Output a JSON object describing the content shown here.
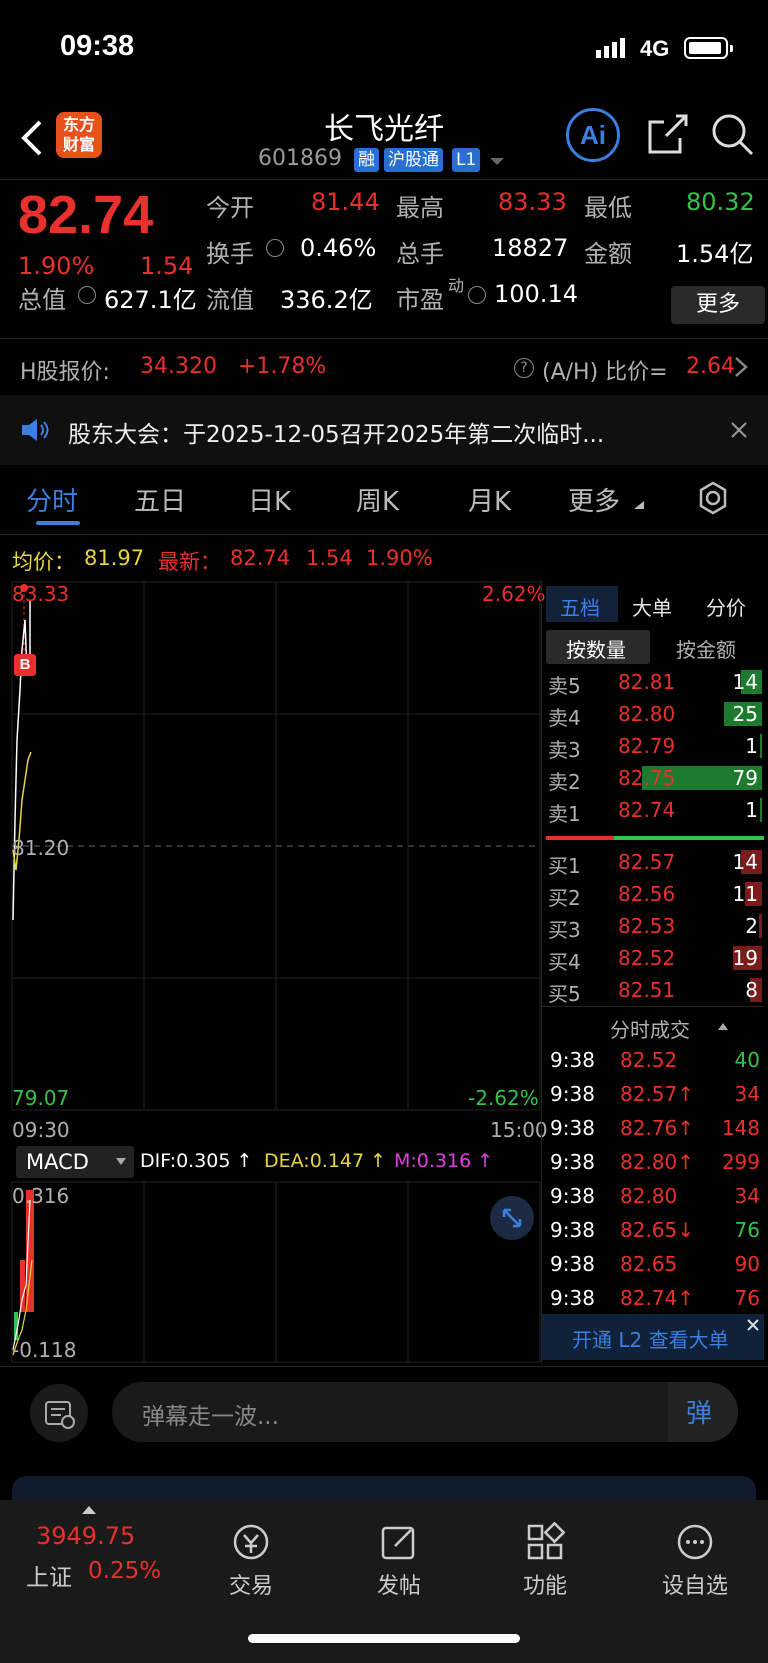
{
  "status": {
    "time": "09:38",
    "network": "4G"
  },
  "header": {
    "logo_line1": "东方",
    "logo_line2": "财富",
    "title": "长飞光纤",
    "code": "601869",
    "tags": [
      "融",
      "沪股通",
      "L1"
    ],
    "ai_label": "Ai"
  },
  "quote": {
    "price": "82.74",
    "pct": "1.90%",
    "chg": "1.54",
    "open_label": "今开",
    "open": "81.44",
    "high_label": "最高",
    "high": "83.33",
    "low_label": "最低",
    "low": "80.32",
    "turnover_label": "换手",
    "turnover": "0.46%",
    "volume_label": "总手",
    "volume": "18827",
    "amount_label": "金额",
    "amount": "1.54亿",
    "mcap_label": "总值",
    "mcap": "627.1亿",
    "float_label": "流值",
    "float": "336.2亿",
    "pe_label": "市盈",
    "pe_sup": "动",
    "pe": "100.14",
    "more": "更多"
  },
  "hshare": {
    "label": "H股报价:",
    "price": "34.320",
    "pct": "+1.78%",
    "ratio_label": "(A/H) 比价=",
    "ratio": "2.64"
  },
  "notice": {
    "text": "股东大会：于2025-12-05召开2025年第二次临时..."
  },
  "tabs": [
    "分时",
    "五日",
    "日K",
    "周K",
    "月K",
    "更多"
  ],
  "chart": {
    "avg_label": "均价：",
    "avg": "81.97",
    "latest_label": "最新：",
    "latest": "82.74",
    "chg": "1.54",
    "pct": "1.90%",
    "top_price": "83.33",
    "top_pct": "2.62%",
    "mid_price": "81.20",
    "bottom_price": "79.07",
    "bottom_pct": "-2.62%",
    "t_start": "09:30",
    "t_end": "15:00",
    "marker": "B"
  },
  "macd": {
    "label": "MACD",
    "dif": "DIF:0.305 ↑",
    "dea": "DEA:0.147 ↑",
    "m": "M:0.316 ↑",
    "top": "0.316",
    "bottom": "-0.118"
  },
  "orderbook": {
    "tabs": [
      "五档",
      "大单",
      "分价"
    ],
    "subtabs": [
      "按数量",
      "按金额"
    ],
    "asks": [
      {
        "label": "卖5",
        "price": "82.81",
        "qty": "14"
      },
      {
        "label": "卖4",
        "price": "82.80",
        "qty": "25"
      },
      {
        "label": "卖3",
        "price": "82.79",
        "qty": "1"
      },
      {
        "label": "卖2",
        "price": "82.75",
        "qty": "79"
      },
      {
        "label": "卖1",
        "price": "82.74",
        "qty": "1"
      }
    ],
    "bids": [
      {
        "label": "买1",
        "price": "82.57",
        "qty": "14"
      },
      {
        "label": "买2",
        "price": "82.56",
        "qty": "11"
      },
      {
        "label": "买3",
        "price": "82.53",
        "qty": "2"
      },
      {
        "label": "买4",
        "price": "82.52",
        "qty": "19"
      },
      {
        "label": "买5",
        "price": "82.51",
        "qty": "8"
      }
    ]
  },
  "ticks": {
    "title": "分时成交",
    "rows": [
      {
        "t": "9:38",
        "p": "82.52",
        "v": "40"
      },
      {
        "t": "9:38",
        "p": "82.57↑",
        "v": "34"
      },
      {
        "t": "9:38",
        "p": "82.76↑",
        "v": "148"
      },
      {
        "t": "9:38",
        "p": "82.80↑",
        "v": "299"
      },
      {
        "t": "9:38",
        "p": "82.80",
        "v": "34"
      },
      {
        "t": "9:38",
        "p": "82.65↓",
        "v": "76"
      },
      {
        "t": "9:38",
        "p": "82.65",
        "v": "90"
      },
      {
        "t": "9:38",
        "p": "82.74↑",
        "v": "76"
      }
    ],
    "l2": "开通 L2 查看大单"
  },
  "danmu": {
    "placeholder": "弹幕走一波..."
  },
  "bottom": {
    "index_value": "3949.75",
    "index_name": "上证",
    "index_pct": "0.25%",
    "items": [
      "交易",
      "发帖",
      "功能",
      "设自选"
    ]
  }
}
